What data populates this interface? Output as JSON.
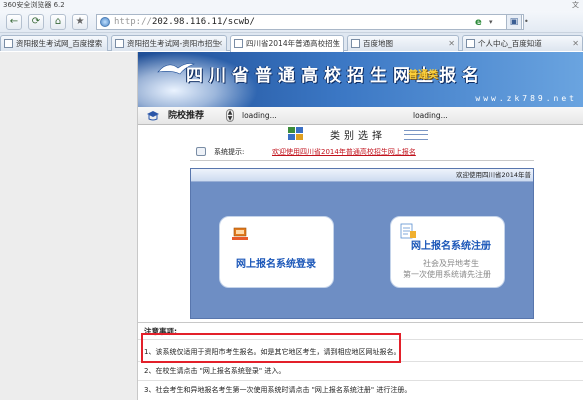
{
  "window": {
    "title": "360安全浏览器 6.2",
    "corner_text": "文"
  },
  "toolbar": {
    "back": "←",
    "refresh": "⟳",
    "home": "⌂",
    "favorite": "★",
    "url_prefix": "http://",
    "url": "202.98.116.11/scwb/",
    "engine_icon": "e",
    "dropdown": "▾",
    "ext": "▣",
    "more": "•"
  },
  "tabs": [
    {
      "label": "资阳报生考试网_百度搜索",
      "active": false
    },
    {
      "label": "资阳招生考试网-资阳市招生",
      "active": false
    },
    {
      "label": "四川省2014年普通高校招生",
      "active": true
    },
    {
      "label": "百度地图",
      "active": false
    },
    {
      "label": "个人中心_百度知道",
      "active": false
    }
  ],
  "tab_close": "✕",
  "banner": {
    "title": "四川省普通高校招生网上报名",
    "tag": "普通类",
    "site": "www.zk789.net"
  },
  "subbar": {
    "label": "院校推荐",
    "loading1": "loading...",
    "loading2": "loading..."
  },
  "category": {
    "title": "类别选择"
  },
  "notice": {
    "label": "系统提示:",
    "link": "欢迎使用四川省2014年普通高校招生网上报名"
  },
  "panel": {
    "marquee": "欢迎使用四川省2014年普"
  },
  "cards": {
    "login": {
      "title": "网上报名系统登录"
    },
    "register": {
      "title": "网上报名系统注册",
      "sub1": "社会及异地考生",
      "sub2": "第一次使用系统请先注册"
    }
  },
  "notes": {
    "title": "注意事项:",
    "items": [
      "1、该系统仅适用于资阳市考生报名。如是其它地区考生，请到相应地区网址报名。",
      "2、在校生请点击 \"网上报名系统登录\" 进入。",
      "3、社会考生和异地报名考生第一次使用系统时请点击 \"网上报名系统注册\" 进行注册。"
    ]
  },
  "colors": {
    "accent_blue": "#1a56b8",
    "panel_blue": "#6e8ec4",
    "highlight_red": "#e3202a",
    "notice_red": "#c1121c"
  }
}
